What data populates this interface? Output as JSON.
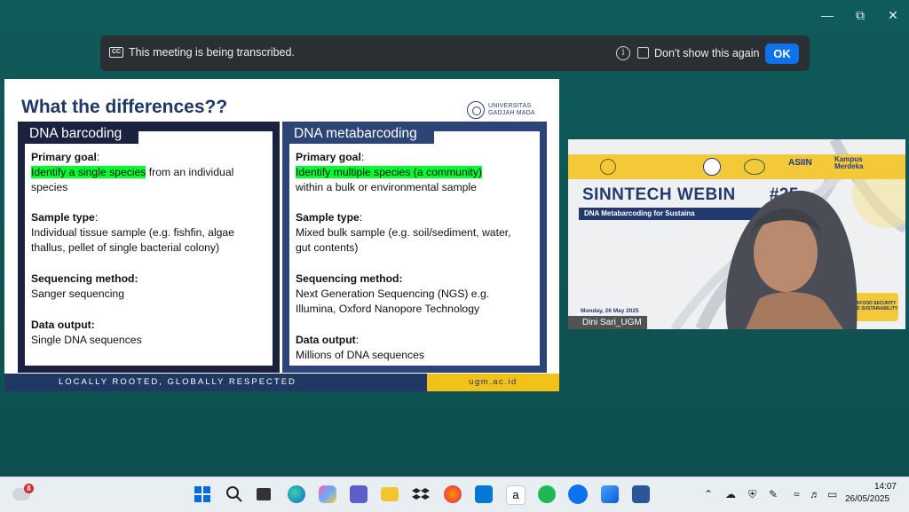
{
  "window": {
    "minimize_icon": "minimize-icon",
    "restore_icon": "restore-icon",
    "close_icon": "close-icon"
  },
  "banner": {
    "message": "This meeting is being transcribed.",
    "dont_show_label": "Don't show this again",
    "ok_label": "OK"
  },
  "slide": {
    "title": "What the differences??",
    "university_line1": "UNIVERSITAS",
    "university_line2": "GADJAH MADA",
    "left": {
      "header": "DNA barcoding",
      "goal_label": "Primary goal",
      "goal_colon": ":",
      "goal_highlight": "Identify a single species",
      "goal_rest1": " from an individual",
      "goal_rest2": "species",
      "sample_label": "Sample type",
      "sample_colon": ":",
      "sample_line1": "Individual tissue sample (e.g. fishfin, algae",
      "sample_line2": "thallus, pellet of single bacterial colony)",
      "seq_label": "Sequencing method:",
      "seq_line1": "Sanger sequencing",
      "out_label": "Data output:",
      "out_line1": "Single DNA sequences"
    },
    "right": {
      "header": "DNA metabarcoding",
      "goal_label": "Primary goal",
      "goal_colon": ":",
      "goal_highlight": "Identify multiple species (a community)",
      "goal_rest2": "within a bulk or environmental sample",
      "sample_label": "Sample type",
      "sample_colon": ":",
      "sample_line1": "Mixed bulk sample (e.g. soil/sediment, water,",
      "sample_line2": "gut contents)",
      "seq_label": "Sequencing method:",
      "seq_line1": "Next Generation Sequencing (NGS) e.g.",
      "seq_line2": "Illumina, Oxford Nanopore Technology",
      "out_label": "Data output",
      "out_colon": ":",
      "out_line1": "Millions of DNA sequences"
    },
    "footer_text": "LOCALLY ROOTED, GLOBALLY RESPECTED",
    "footer_url": "ugm.ac.id"
  },
  "speaker": {
    "title": "SINNTECH WEBIN",
    "title_suffix": "#25",
    "subtitle": "DNA Metabarcoding for Sustaina",
    "date": "Monday, 26 May 2025",
    "badge_line1": "SEAFOOD SECURITY",
    "badge_line2": "AND SUSTAINABILITY",
    "logo_asiin": "ASIIN",
    "logo_kampus": "Kampus",
    "logo_merdeka": "Merdeka",
    "name": "Dini Sari_UGM"
  },
  "taskbar": {
    "weather_badge": "8",
    "time": "14:07",
    "date": "26/05/2025",
    "colors": {
      "accent": "#0e72ed",
      "highlight": "#00ff2f",
      "navy": "#1f3864",
      "gold": "#f2c11a"
    }
  }
}
